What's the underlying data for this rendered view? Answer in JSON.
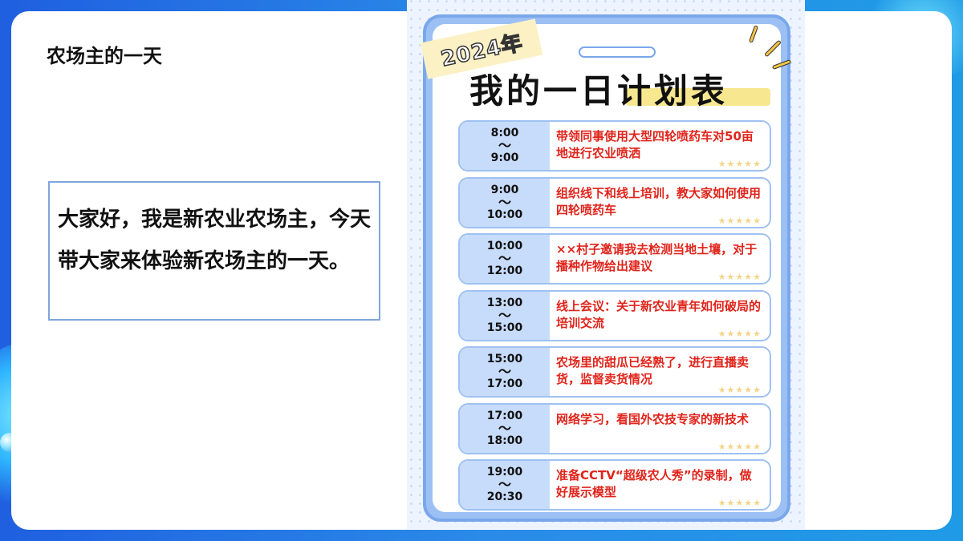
{
  "slide": {
    "title": "农场主的一天",
    "intro": "大家好，我是新农业农场主，今天带大家来体验新农场主的一天。"
  },
  "planner": {
    "year": "2024年",
    "title": "我的一日计划表",
    "stars": "★★★★★",
    "rows": [
      {
        "start": "8:00",
        "sep": "～",
        "end": "9:00",
        "task": "带领同事使用大型四轮喷药车对50亩地进行农业喷洒"
      },
      {
        "start": "9:00",
        "sep": "～",
        "end": "10:00",
        "task": "组织线下和线上培训，教大家如何使用四轮喷药车"
      },
      {
        "start": "10:00",
        "sep": "～",
        "end": "12:00",
        "task": "××村子邀请我去检测当地土壤，对于播种作物给出建议"
      },
      {
        "start": "13:00",
        "sep": "～",
        "end": "15:00",
        "task": "线上会议：关于新农业青年如何破局的培训交流"
      },
      {
        "start": "15:00",
        "sep": "～",
        "end": "17:00",
        "task": "农场里的甜瓜已经熟了，进行直播卖货，监督卖货情况"
      },
      {
        "start": "17:00",
        "sep": "～",
        "end": "18:00",
        "task": "网络学习，看国外农技专家的新技术"
      },
      {
        "start": "19:00",
        "sep": "～",
        "end": "20:30",
        "task": "准备CCTV“超级农人秀”的录制，做好展示模型"
      }
    ]
  }
}
